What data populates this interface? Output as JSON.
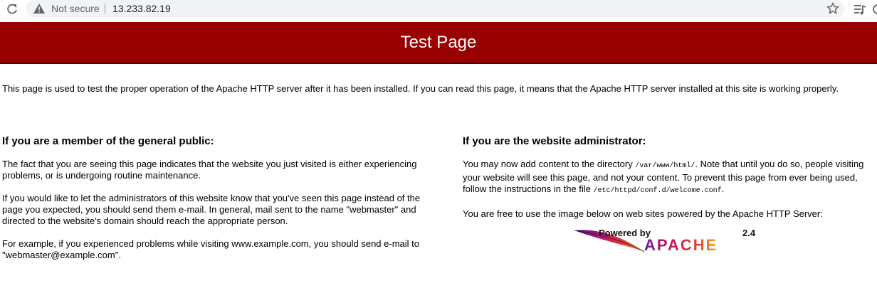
{
  "browser": {
    "security_label": "Not secure",
    "url": "13.233.82.19"
  },
  "banner": {
    "title": "Test Page"
  },
  "intro": "This page is used to test the proper operation of the Apache HTTP server after it has been installed. If you can read this page, it means that the Apache HTTP server installed at this site is working properly.",
  "public": {
    "heading": "If you are a member of the general public:",
    "p1": "The fact that you are seeing this page indicates that the website you just visited is either experiencing problems, or is undergoing routine maintenance.",
    "p2": "If you would like to let the administrators of this website know that you've seen this page instead of the page you expected, you should send them e-mail. In general, mail sent to the name \"webmaster\" and directed to the website's domain should reach the appropriate person.",
    "p3": "For example, if you experienced problems while visiting www.example.com, you should send e-mail to \"webmaster@example.com\"."
  },
  "admin": {
    "heading": "If you are the website administrator:",
    "p1_a": "You may now add content to the directory ",
    "p1_dir": "/var/www/html/",
    "p1_b": ". Note that until you do so, people visiting your website will see this page, and not your content. To prevent this page from ever being used, follow the instructions in the file ",
    "p1_file": "/etc/httpd/conf.d/welcome.conf",
    "p1_c": ".",
    "p2": "You are free to use the image below on web sites powered by the Apache HTTP Server:"
  },
  "logo": {
    "powered_by": "Powered by",
    "version": "2.4",
    "name": "APACHE"
  },
  "icons": {
    "reload": "reload-icon",
    "warning": "warning-icon",
    "star": "star-icon",
    "reading_list": "reading-list-icon",
    "feather": "feather-icon"
  },
  "colors": {
    "banner": "#990000",
    "banner_text": "#ffffff",
    "omnibox": "#f1f3f4"
  }
}
